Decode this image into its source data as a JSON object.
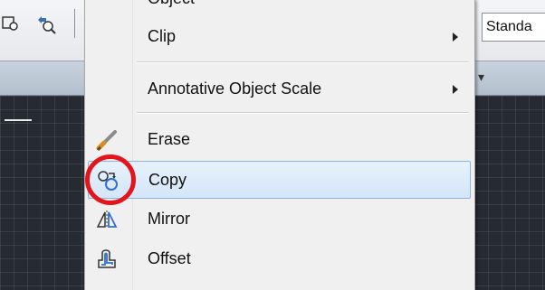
{
  "toolbar": {
    "text_style_value": "Standa"
  },
  "menu": {
    "cut_item_label": "Object",
    "items": [
      {
        "label": "Clip",
        "submenu": true,
        "icon": "none"
      },
      {
        "label": "Annotative Object Scale",
        "submenu": true,
        "icon": "none"
      },
      {
        "label": "Erase",
        "submenu": false,
        "icon": "eraser-icon"
      },
      {
        "label": "Copy",
        "submenu": false,
        "icon": "copy-icon",
        "highlighted": true
      },
      {
        "label": "Mirror",
        "submenu": false,
        "icon": "mirror-icon"
      },
      {
        "label": "Offset",
        "submenu": false,
        "icon": "offset-icon"
      }
    ]
  },
  "annotation": {
    "color": "#e5131b",
    "target": "copy-icon"
  },
  "colors": {
    "menu_background": "#f0f0f0",
    "highlight_background": "#d4e6f8",
    "highlight_border": "#8fb5de",
    "canvas": "#262a31"
  }
}
